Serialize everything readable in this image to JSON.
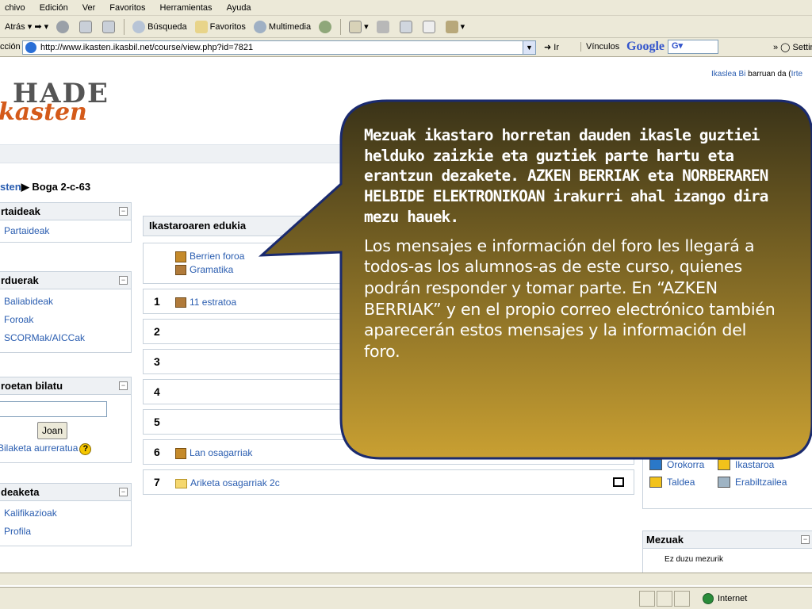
{
  "browser": {
    "menu": [
      "chivo",
      "Edición",
      "Ver",
      "Favoritos",
      "Herramientas",
      "Ayuda"
    ],
    "toolbar": {
      "back": "Atrás",
      "search": "Búsqueda",
      "favorites": "Favoritos",
      "media": "Multimedia"
    },
    "address_label": "cción",
    "url": "http://www.ikasten.ikasbil.net/course/view.php?id=7821",
    "go": "Ir",
    "links": "Vínculos",
    "google": "Google",
    "google_box": "G▾",
    "settings": "Settin",
    "status_zone": "Internet"
  },
  "page": {
    "logo_top": "HADE",
    "logo_bottom": "kasten",
    "login_prefix": "Ikaslea Bi",
    "login_suffix": "barruan da (",
    "login_link": "Irte",
    "breadcrumb_link": "sten",
    "breadcrumb_sep": "▶",
    "breadcrumb_current": "Boga 2-c-63"
  },
  "blocks": {
    "participants": {
      "title": "rtaideak",
      "items": [
        "Partaideak"
      ]
    },
    "resources": {
      "title": "rduerak",
      "items": [
        "Baliabideak",
        "Foroak",
        "SCORMak/AICCak"
      ]
    },
    "search": {
      "title": "roetan bilatu",
      "button": "Joan",
      "advanced": "Bilaketa aurreratua"
    },
    "admin": {
      "title": "deaketa",
      "items": [
        "Kalifikazioak",
        "Profila"
      ]
    }
  },
  "course": {
    "header": "Ikastaroaren edukia",
    "section0": [
      "Berrien foroa",
      "Gramatika"
    ],
    "sections": [
      {
        "num": "1",
        "activity": "11 estratoa",
        "icon": "box"
      },
      {
        "num": "2",
        "activity": "",
        "icon": ""
      },
      {
        "num": "3",
        "activity": "",
        "icon": ""
      },
      {
        "num": "4",
        "activity": "",
        "icon": ""
      },
      {
        "num": "5",
        "activity": "",
        "icon": ""
      },
      {
        "num": "6",
        "activity": "Lan osagarriak",
        "icon": "forum"
      },
      {
        "num": "7",
        "activity": "Ariketa osagarriak 2c",
        "icon": "folder"
      }
    ]
  },
  "events": {
    "items": [
      {
        "label": "Orokorra",
        "color": "#2a78c8"
      },
      {
        "label": "Ikastaroa",
        "color": "#f2c21b"
      },
      {
        "label": "Taldea",
        "color": "#f2c21b"
      },
      {
        "label": "Erabiltzailea",
        "color": "#9fb4c4"
      }
    ]
  },
  "messages": {
    "title": "Mezuak",
    "toggle": "−",
    "body": "Ez duzu mezurik"
  },
  "callout": {
    "basque": "Mezuak ikastaro horretan dauden ikasle guztiei helduko zaizkie eta guztiek parte hartu eta erantzun dezakete. AZKEN BERRIAK eta NORBERAREN HELBIDE ELEKTRONIKOAN irakurri ahal izango dira mezu hauek.",
    "spanish": "Los mensajes e información del foro les llegará a todos-as los alumnos-as de este curso, quienes podrán responder y tomar parte. En “AZKEN BERRIAK” y en el propio correo electrónico también aparecerán estos mensajes y la información del foro.",
    "fill_top": "#3a3318",
    "fill_bottom": "#c9a032",
    "border": "#1a2a6e"
  }
}
